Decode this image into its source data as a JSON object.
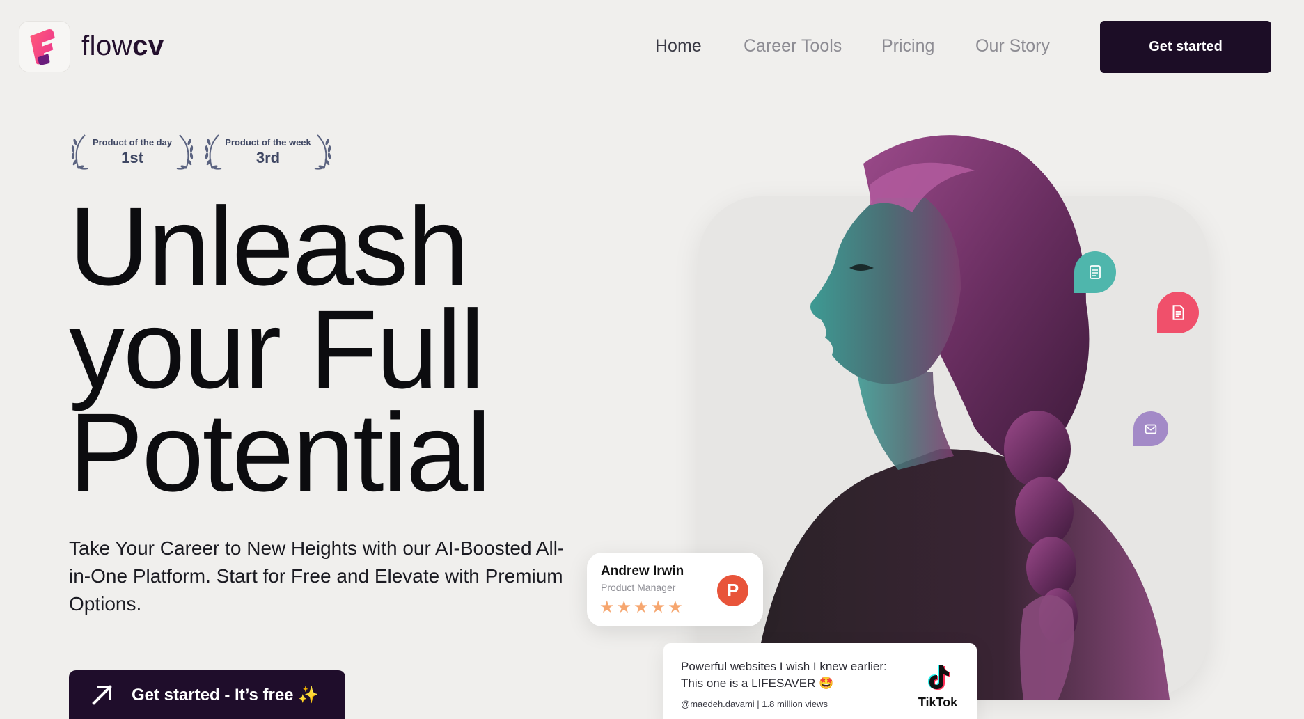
{
  "header": {
    "logo_text_light": "flow",
    "logo_text_bold": "cv",
    "nav": [
      "Home",
      "Career Tools",
      "Pricing",
      "Our Story"
    ],
    "cta_label": "Get started"
  },
  "awards": [
    {
      "title": "Product of the day",
      "rank": "1st"
    },
    {
      "title": "Product of the week",
      "rank": "3rd"
    }
  ],
  "hero": {
    "line1": "Unleash",
    "line2": "your Full",
    "line3": "Potential",
    "subtitle": "Take Your Career to New Heights with our AI-Boosted All-in-One Platform. Start for Free and Elevate with Premium Options.",
    "cta_label": "Get started - It’s free ✨"
  },
  "review": {
    "name": "Andrew Irwin",
    "role": "Product Manager",
    "stars": "★★★★★",
    "badge_letter": "P"
  },
  "tiktok": {
    "quote": "Powerful websites I wish I knew earlier: This one is a LIFESAVER 🤩",
    "meta": "@maedeh.davami | 1.8 million views",
    "brand": "TikTok"
  },
  "colors": {
    "background": "#f0efed",
    "dark": "#1c0d26",
    "teal": "#4fb6ac",
    "pink": "#f0506b",
    "purple": "#a38ac7",
    "star": "#f6a66f",
    "producthunt": "#e8543a"
  },
  "icons": {
    "logo": "flowcv-logo-icon",
    "arrow": "arrow-up-right-icon",
    "bubble_1": "resume-icon",
    "bubble_2": "document-icon",
    "bubble_3": "letter-icon"
  }
}
